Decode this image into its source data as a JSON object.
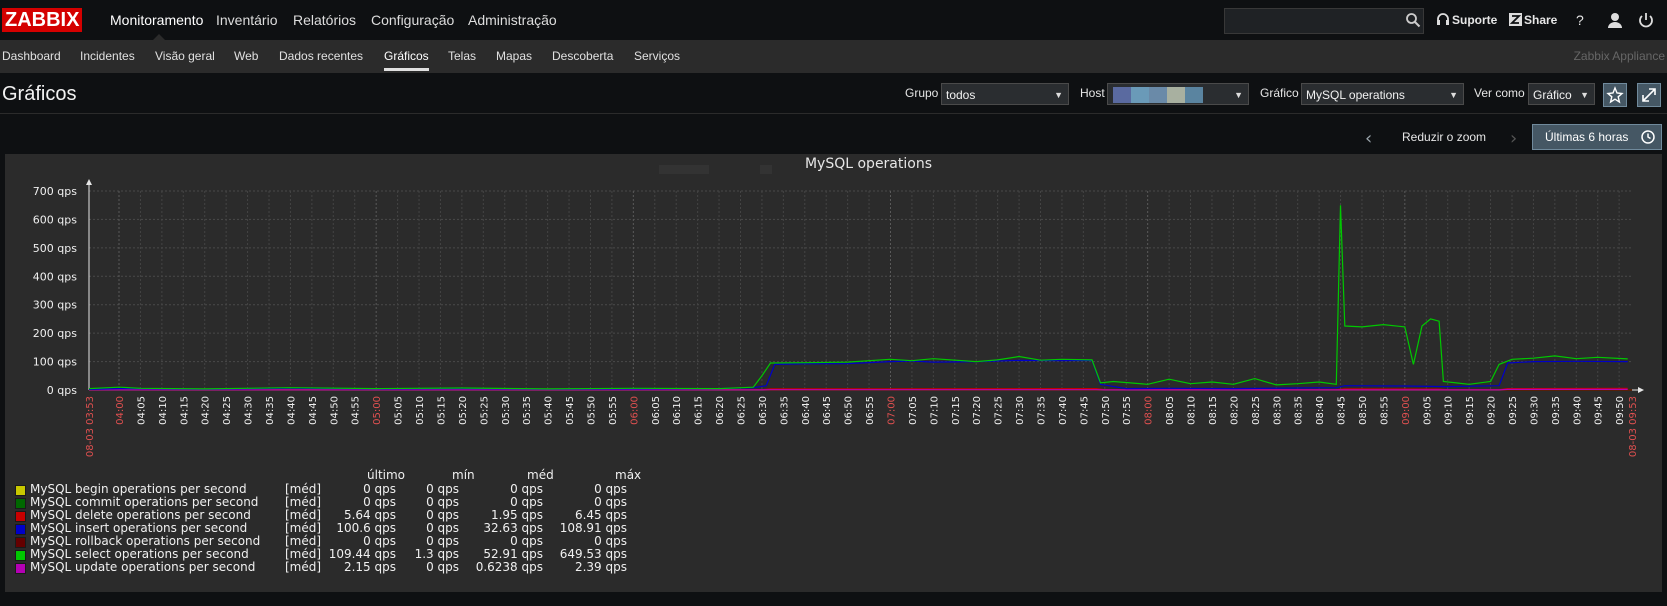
{
  "app": {
    "logo": "ZABBIX"
  },
  "main_menu": [
    "Monitoramento",
    "Inventário",
    "Relatórios",
    "Configuração",
    "Administração"
  ],
  "header": {
    "support": "Suporte",
    "share": "Share",
    "help": "?"
  },
  "sub_menu": [
    "Dashboard",
    "Incidentes",
    "Visão geral",
    "Web",
    "Dados recentes",
    "Gráficos",
    "Telas",
    "Mapas",
    "Descoberta",
    "Serviços"
  ],
  "appliance": "Zabbix Appliance",
  "page_title": "Gráficos",
  "filters": {
    "group_label": "Grupo",
    "group_value": "todos",
    "host_label": "Host",
    "graph_label": "Gráfico",
    "graph_value": "MySQL operations",
    "view_label": "Ver como",
    "view_value": "Gráfico"
  },
  "time": {
    "zoom_out": "Reduzir o zoom",
    "range": "Últimas 6 horas"
  },
  "colors": {
    "accent": "#455764",
    "logo_red": "#d40000",
    "panel": "#2b2b2b"
  },
  "chart_data": {
    "type": "line",
    "title": "MySQL operations",
    "ylim": [
      0,
      700
    ],
    "y_ticks": [
      "0 qps",
      "100 qps",
      "200 qps",
      "300 qps",
      "400 qps",
      "500 qps",
      "600 qps",
      "700 qps"
    ],
    "x_start": "08-03 03:53",
    "x_end": "08-03 09:53",
    "x_ticks": [
      "04:00",
      "04:05",
      "04:10",
      "04:15",
      "04:20",
      "04:25",
      "04:30",
      "04:35",
      "04:40",
      "04:45",
      "04:50",
      "04:55",
      "05:00",
      "05:05",
      "05:10",
      "05:15",
      "05:20",
      "05:25",
      "05:30",
      "05:35",
      "05:40",
      "05:45",
      "05:50",
      "05:55",
      "06:00",
      "06:05",
      "06:10",
      "06:15",
      "06:20",
      "06:25",
      "06:30",
      "06:35",
      "06:40",
      "06:45",
      "06:50",
      "06:55",
      "07:00",
      "07:05",
      "07:10",
      "07:15",
      "07:20",
      "07:25",
      "07:30",
      "07:35",
      "07:40",
      "07:45",
      "07:50",
      "07:55",
      "08:00",
      "08:05",
      "08:10",
      "08:15",
      "08:20",
      "08:25",
      "08:30",
      "08:35",
      "08:40",
      "08:45",
      "08:50",
      "08:55",
      "09:00",
      "09:05",
      "09:10",
      "09:15",
      "09:20",
      "09:25",
      "09:30",
      "09:35",
      "09:40",
      "09:45",
      "09:50"
    ],
    "hour_ticks": [
      "04:00",
      "05:00",
      "06:00",
      "07:00",
      "08:00",
      "09:00"
    ],
    "grid": true,
    "legend_headers": [
      "último",
      "mín",
      "méd",
      "máx"
    ],
    "series": [
      {
        "name": "MySQL begin operations per second",
        "func": "[méd]",
        "color": "#c8c800",
        "last": "0 qps",
        "min": "0 qps",
        "avg": "0 qps",
        "max": "0 qps",
        "points": [
          [
            "03:53",
            0
          ],
          [
            "09:53",
            0
          ]
        ]
      },
      {
        "name": "MySQL commit operations per second",
        "func": "[méd]",
        "color": "#006800",
        "last": "0 qps",
        "min": "0 qps",
        "avg": "0 qps",
        "max": "0 qps",
        "points": [
          [
            "03:53",
            0
          ],
          [
            "09:53",
            0
          ]
        ]
      },
      {
        "name": "MySQL delete operations per second",
        "func": "[méd]",
        "color": "#c80000",
        "last": "5.64 qps",
        "min": "0 qps",
        "avg": "1.95 qps",
        "max": "6.45 qps",
        "points": [
          [
            "03:53",
            1
          ],
          [
            "06:30",
            1
          ],
          [
            "06:32",
            4
          ],
          [
            "07:48",
            5
          ],
          [
            "07:50",
            1
          ],
          [
            "08:44",
            1
          ],
          [
            "08:46",
            4
          ],
          [
            "09:08",
            3
          ],
          [
            "09:10",
            1
          ],
          [
            "09:22",
            1
          ],
          [
            "09:24",
            5
          ],
          [
            "09:52",
            6
          ]
        ]
      },
      {
        "name": "MySQL insert operations per second",
        "func": "[méd]",
        "color": "#0000c8",
        "last": "100.6 qps",
        "min": "0 qps",
        "avg": "32.63 qps",
        "max": "108.91 qps",
        "points": [
          [
            "03:53",
            2
          ],
          [
            "04:00",
            5
          ],
          [
            "04:20",
            3
          ],
          [
            "04:40",
            6
          ],
          [
            "05:00",
            4
          ],
          [
            "05:20",
            5
          ],
          [
            "05:40",
            3
          ],
          [
            "06:00",
            4
          ],
          [
            "06:20",
            5
          ],
          [
            "06:28",
            8
          ],
          [
            "06:31",
            15
          ],
          [
            "06:33",
            90
          ],
          [
            "06:40",
            92
          ],
          [
            "06:50",
            93
          ],
          [
            "07:00",
            100
          ],
          [
            "07:05",
            102
          ],
          [
            "07:10",
            98
          ],
          [
            "07:20",
            100
          ],
          [
            "07:30",
            104
          ],
          [
            "07:40",
            103
          ],
          [
            "07:47",
            104
          ],
          [
            "07:49",
            20
          ],
          [
            "07:55",
            5
          ],
          [
            "08:05",
            6
          ],
          [
            "08:20",
            5
          ],
          [
            "08:35",
            7
          ],
          [
            "08:44",
            8
          ],
          [
            "08:46",
            15
          ],
          [
            "09:00",
            14
          ],
          [
            "09:10",
            12
          ],
          [
            "09:22",
            15
          ],
          [
            "09:24",
            95
          ],
          [
            "09:30",
            100
          ],
          [
            "09:40",
            101
          ],
          [
            "09:52",
            100
          ]
        ]
      },
      {
        "name": "MySQL rollback operations per second",
        "func": "[méd]",
        "color": "#640000",
        "last": "0 qps",
        "min": "0 qps",
        "avg": "0 qps",
        "max": "0 qps",
        "points": [
          [
            "03:53",
            0
          ],
          [
            "09:53",
            0
          ]
        ]
      },
      {
        "name": "MySQL select operations per second",
        "func": "[méd]",
        "color": "#00c800",
        "last": "109.44 qps",
        "min": "1.3 qps",
        "avg": "52.91 qps",
        "max": "649.53 qps",
        "points": [
          [
            "03:53",
            5
          ],
          [
            "04:00",
            10
          ],
          [
            "04:05",
            6
          ],
          [
            "04:20",
            4
          ],
          [
            "04:40",
            8
          ],
          [
            "05:00",
            5
          ],
          [
            "05:20",
            7
          ],
          [
            "05:40",
            4
          ],
          [
            "06:00",
            6
          ],
          [
            "06:20",
            5
          ],
          [
            "06:28",
            10
          ],
          [
            "06:30",
            50
          ],
          [
            "06:32",
            95
          ],
          [
            "06:40",
            96
          ],
          [
            "06:50",
            98
          ],
          [
            "07:00",
            108
          ],
          [
            "07:05",
            103
          ],
          [
            "07:10",
            110
          ],
          [
            "07:20",
            100
          ],
          [
            "07:25",
            106
          ],
          [
            "07:30",
            118
          ],
          [
            "07:35",
            105
          ],
          [
            "07:40",
            108
          ],
          [
            "07:47",
            106
          ],
          [
            "07:49",
            25
          ],
          [
            "07:52",
            30
          ],
          [
            "08:00",
            20
          ],
          [
            "08:05",
            38
          ],
          [
            "08:10",
            22
          ],
          [
            "08:15",
            28
          ],
          [
            "08:20",
            20
          ],
          [
            "08:25",
            40
          ],
          [
            "08:30",
            18
          ],
          [
            "08:35",
            22
          ],
          [
            "08:40",
            28
          ],
          [
            "08:44",
            20
          ],
          [
            "08:45",
            649.53
          ],
          [
            "08:46",
            225
          ],
          [
            "08:50",
            222
          ],
          [
            "08:55",
            230
          ],
          [
            "09:00",
            222
          ],
          [
            "09:02",
            90
          ],
          [
            "09:04",
            225
          ],
          [
            "09:06",
            250
          ],
          [
            "09:08",
            242
          ],
          [
            "09:09",
            30
          ],
          [
            "09:12",
            25
          ],
          [
            "09:15",
            20
          ],
          [
            "09:20",
            30
          ],
          [
            "09:22",
            90
          ],
          [
            "09:25",
            108
          ],
          [
            "09:30",
            112
          ],
          [
            "09:35",
            120
          ],
          [
            "09:40",
            110
          ],
          [
            "09:45",
            115
          ],
          [
            "09:52",
            109.44
          ]
        ]
      },
      {
        "name": "MySQL update operations per second",
        "func": "[méd]",
        "color": "#b400b4",
        "last": "2.15 qps",
        "min": "0 qps",
        "avg": "0.6238 qps",
        "max": "2.39 qps",
        "points": [
          [
            "03:53",
            0.5
          ],
          [
            "06:30",
            0.5
          ],
          [
            "06:32",
            1
          ],
          [
            "07:48",
            1
          ],
          [
            "07:50",
            0.5
          ],
          [
            "09:22",
            0.5
          ],
          [
            "09:24",
            2
          ],
          [
            "09:52",
            2.15
          ]
        ]
      }
    ]
  }
}
